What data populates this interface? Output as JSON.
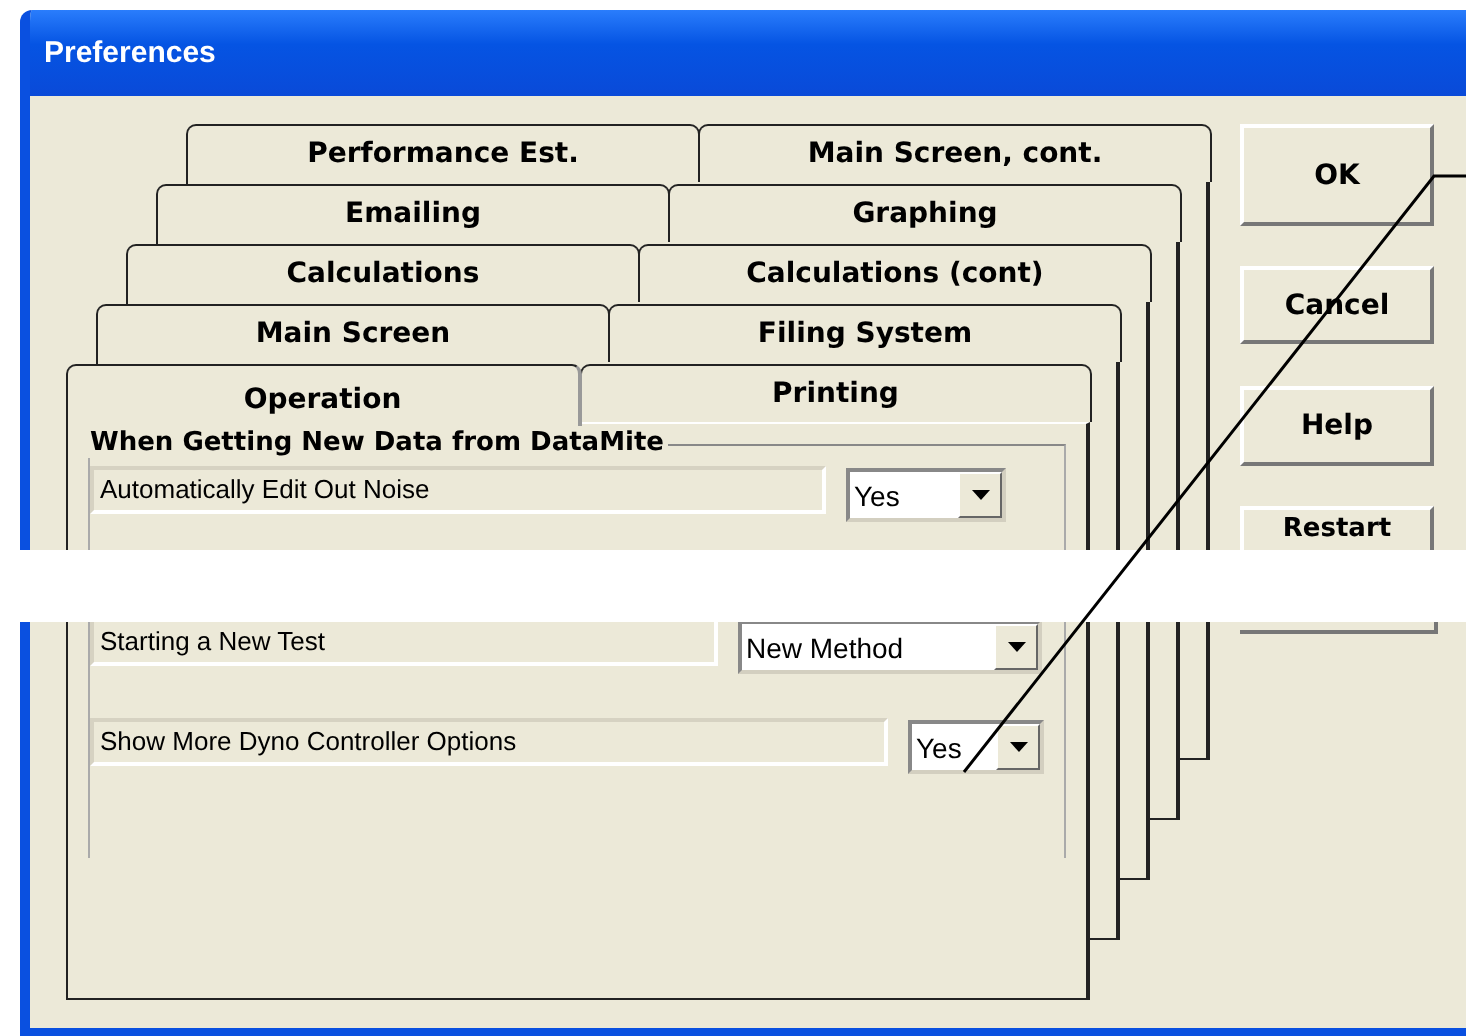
{
  "window": {
    "title": "Preferences"
  },
  "tab_rows": [
    {
      "tabs": [
        {
          "label": "Performance Est.",
          "selected": false
        },
        {
          "label": "Main Screen, cont.",
          "selected": false
        }
      ]
    },
    {
      "tabs": [
        {
          "label": "Emailing",
          "selected": false
        },
        {
          "label": "Graphing",
          "selected": false
        }
      ]
    },
    {
      "tabs": [
        {
          "label": "Calculations",
          "selected": false
        },
        {
          "label": "Calculations (cont)",
          "selected": false
        }
      ]
    },
    {
      "tabs": [
        {
          "label": "Main Screen",
          "selected": false
        },
        {
          "label": "Filing System",
          "selected": false
        }
      ]
    },
    {
      "tabs": [
        {
          "label": "Operation",
          "selected": true
        },
        {
          "label": "Printing",
          "selected": false
        }
      ]
    }
  ],
  "group": {
    "title": "When Getting New Data from DataMite",
    "settings": [
      {
        "label": "Automatically Edit Out Noise",
        "value": "Yes"
      },
      {
        "label": "Starting a New Test",
        "value": "New Method"
      },
      {
        "label": "Show More Dyno Controller Options",
        "value": "Yes"
      }
    ]
  },
  "buttons": [
    "OK",
    "Cancel",
    "Help",
    "Restart"
  ]
}
